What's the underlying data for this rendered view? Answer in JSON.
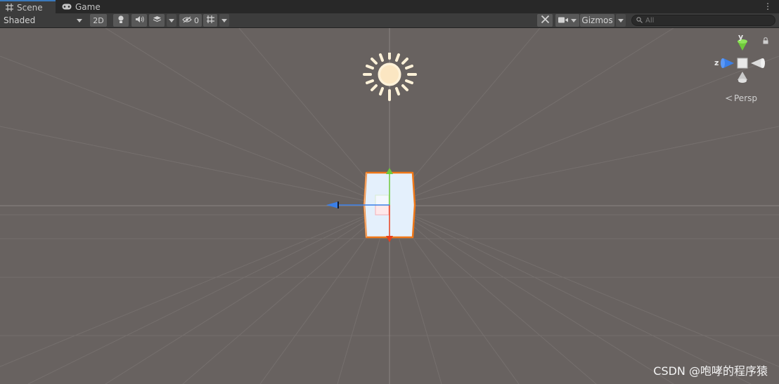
{
  "tabs": [
    {
      "label": "Scene",
      "icon": "grid-icon",
      "active": true
    },
    {
      "label": "Game",
      "icon": "gamepad-icon",
      "active": false
    }
  ],
  "toolbar": {
    "shading_mode": "Shaded",
    "btn_2d": "2D",
    "hidden_count": "0",
    "gizmos_label": "Gizmos",
    "search_placeholder": "All"
  },
  "scene": {
    "orientation_gizmo": {
      "y_label": "y",
      "z_label": "z",
      "projection": "Persp"
    }
  },
  "watermark": "CSDN @咆哮的程序猿",
  "colors": {
    "scene_background": "#686260",
    "selection_outline": "#f07818",
    "axis_x": "#e8401c",
    "axis_y": "#6ec93a",
    "axis_z": "#3a7fe8",
    "tab_active_accent": "#3a79bb"
  }
}
